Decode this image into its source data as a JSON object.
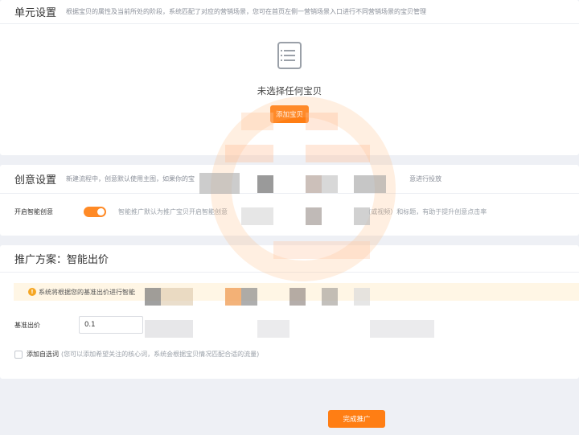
{
  "unit_settings": {
    "title": "单元设置",
    "subtitle": "根据宝贝的属性及当前所处的阶段，系统匹配了对应的营销场景，您可在首页左侧一营销场景入口进行不同营销场景的宝贝管理",
    "empty_icon": "list-document-icon",
    "empty_text": "未选择任何宝贝",
    "add_button": "添加宝贝"
  },
  "creative_settings": {
    "title": "创意设置",
    "subtitle_left": "新建流程中，创意默认使用主图，如果你的宝",
    "subtitle_right": "意进行投放",
    "smart_label": "开启智能创意",
    "smart_enabled": true,
    "smart_desc_left": "智能推广默认为推广宝贝开启智能创意",
    "smart_desc_right": "(或视频）和标题，有助于提升创意点击率"
  },
  "plan": {
    "title": "推广方案：智能出价",
    "notice_text": "系统将根据您的基准出价进行智能",
    "bid_label": "基准出价",
    "bid_value": "0.1",
    "keyword_label": "添加自选词",
    "keyword_hint": "(您可以添加希望关注的核心词，系统会根据宝贝情况匹配合适的流量)",
    "keyword_checked": false
  },
  "finish_button": "完成推广",
  "colors": {
    "accent": "#ff7e14",
    "page_bg": "#eef0f5",
    "notice_bg": "#fff6e5"
  }
}
